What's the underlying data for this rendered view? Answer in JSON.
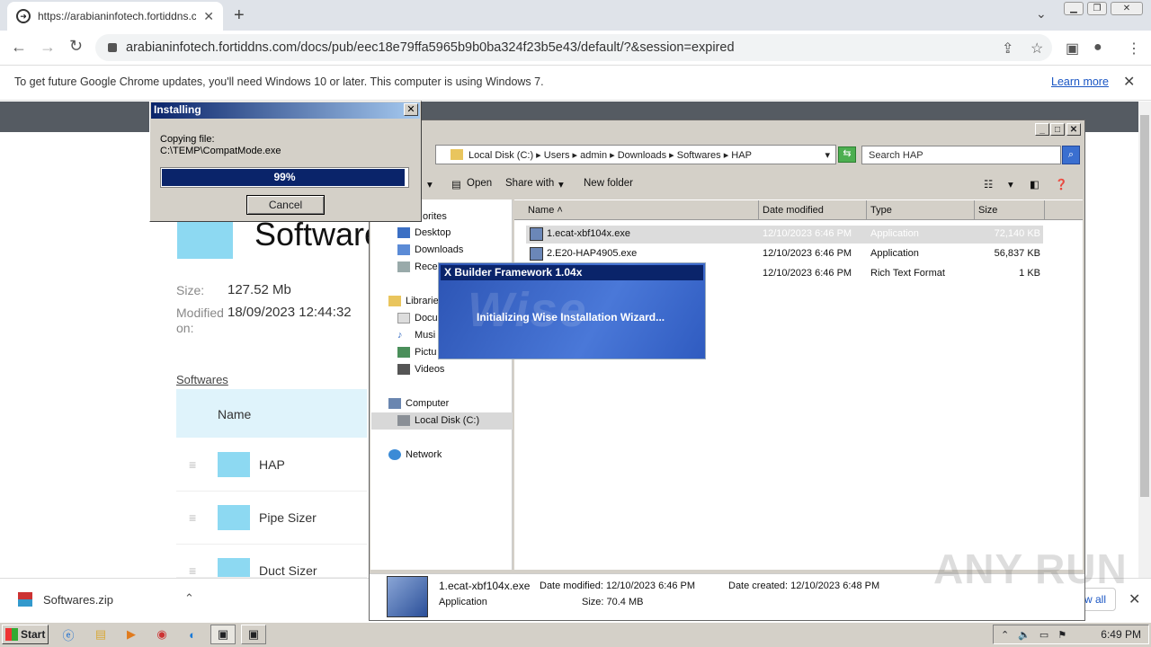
{
  "browser": {
    "tab_title": "https://arabianinfotech.fortiddns.co",
    "url": "arabianinfotech.fortiddns.com/docs/pub/eec18e79ffa5965b9b0ba324f23b5e43/default/?&session=expired",
    "infobar_text": "To get future Google Chrome updates, you'll need Windows 10 or later. This computer is using Windows 7.",
    "learn_more": "Learn more"
  },
  "page": {
    "title": "Software",
    "size_label": "Size:",
    "size_value": "127.52 Mb",
    "modified_label": "Modified",
    "modified_label2": "on:",
    "modified_value": "18/09/2023 12:44:32",
    "breadcrumb": "Softwares",
    "name_header": "Name",
    "folders": [
      "HAP",
      "Pipe Sizer",
      "Duct Sizer"
    ]
  },
  "download": {
    "name": "Softwares.zip",
    "show_all": "w all"
  },
  "installer": {
    "title": "Installing",
    "copying": "Copying file:",
    "path": "C:\\TEMP\\CompatMode.exe",
    "progress_text": "99%",
    "progress": 0.99,
    "cancel": "Cancel"
  },
  "wise": {
    "title": "X Builder Framework 1.04x",
    "message": "Initializing Wise Installation Wizard...",
    "watermark": "Wise"
  },
  "explorer": {
    "address": "Local Disk (C:)  ▸  Users  ▸  admin  ▸  Downloads  ▸  Softwares  ▸  HAP",
    "search_placeholder": "Search HAP",
    "commands": {
      "open": "Open",
      "share": "Share with",
      "newfolder": "New folder"
    },
    "nav": {
      "favorites": "orites",
      "desktop": "Desktop",
      "downloads": "Downloads",
      "recent": "Rece",
      "libraries": "Librarie",
      "documents": "Docu",
      "music": "Musi",
      "pictures": "Pictu",
      "videos": "Videos",
      "computer": "Computer",
      "localdisk": "Local Disk (C:)",
      "network": "Network"
    },
    "columns": {
      "name": "Name",
      "date": "Date modified",
      "type": "Type",
      "size": "Size"
    },
    "files": [
      {
        "name": "1.ecat-xbf104x.exe",
        "date": "12/10/2023 6:46 PM",
        "type": "Application",
        "size": "72,140 KB"
      },
      {
        "name": "2.E20-HAP4905.exe",
        "date": "12/10/2023 6:46 PM",
        "type": "Application",
        "size": "56,837 KB"
      },
      {
        "name": "",
        "date": "12/10/2023 6:46 PM",
        "type": "Rich Text Format",
        "size": "1 KB"
      }
    ],
    "details": {
      "name": "1.ecat-xbf104x.exe",
      "type": "Application",
      "modified": "Date modified: 12/10/2023 6:46 PM",
      "created": "Date created: 12/10/2023 6:48 PM",
      "size": "Size: 70.4 MB"
    }
  },
  "taskbar": {
    "start": "Start",
    "clock": "6:49 PM"
  },
  "watermark": "ANY RUN"
}
